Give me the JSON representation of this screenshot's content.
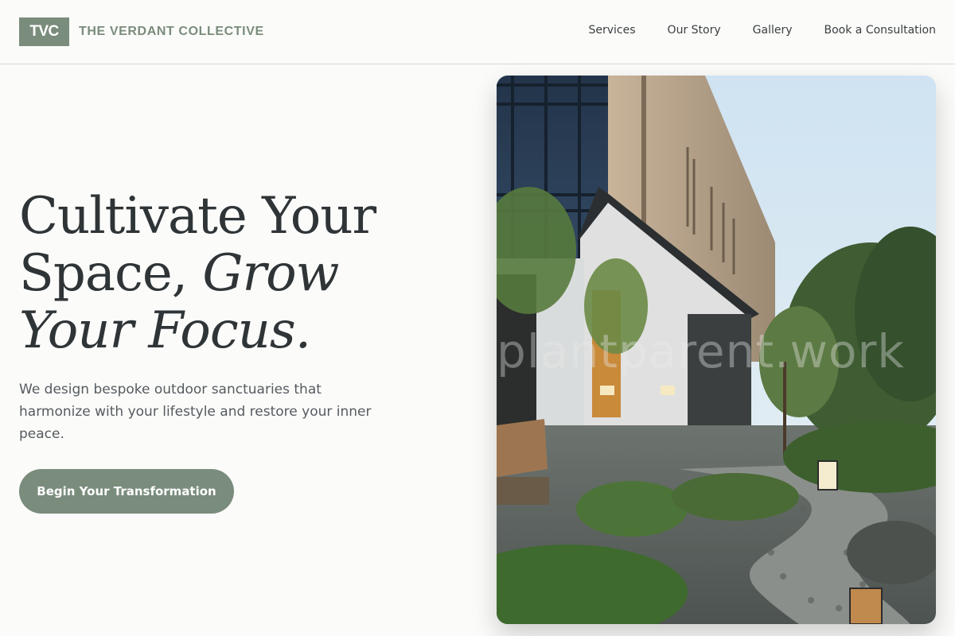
{
  "header": {
    "logo": "TVC",
    "brand_name": "THE VERDANT COLLECTIVE",
    "nav": [
      {
        "label": "Services"
      },
      {
        "label": "Our Story"
      },
      {
        "label": "Gallery"
      },
      {
        "label": "Book a Consultation"
      }
    ]
  },
  "hero": {
    "title_line1": "Cultivate Your",
    "title_line2_plain": "Space, ",
    "title_line2_italic": "Grow",
    "title_line3_italic": "Your Focus.",
    "subtitle": "We design bespoke outdoor sanctuaries that harmonize with your lifestyle and restore your inner peace.",
    "cta_label": "Begin Your Transformation",
    "image_watermark": "plantparent.work"
  },
  "colors": {
    "accent": "#7a8c7c",
    "text": "#2f3437",
    "background": "#fbfbf9"
  }
}
